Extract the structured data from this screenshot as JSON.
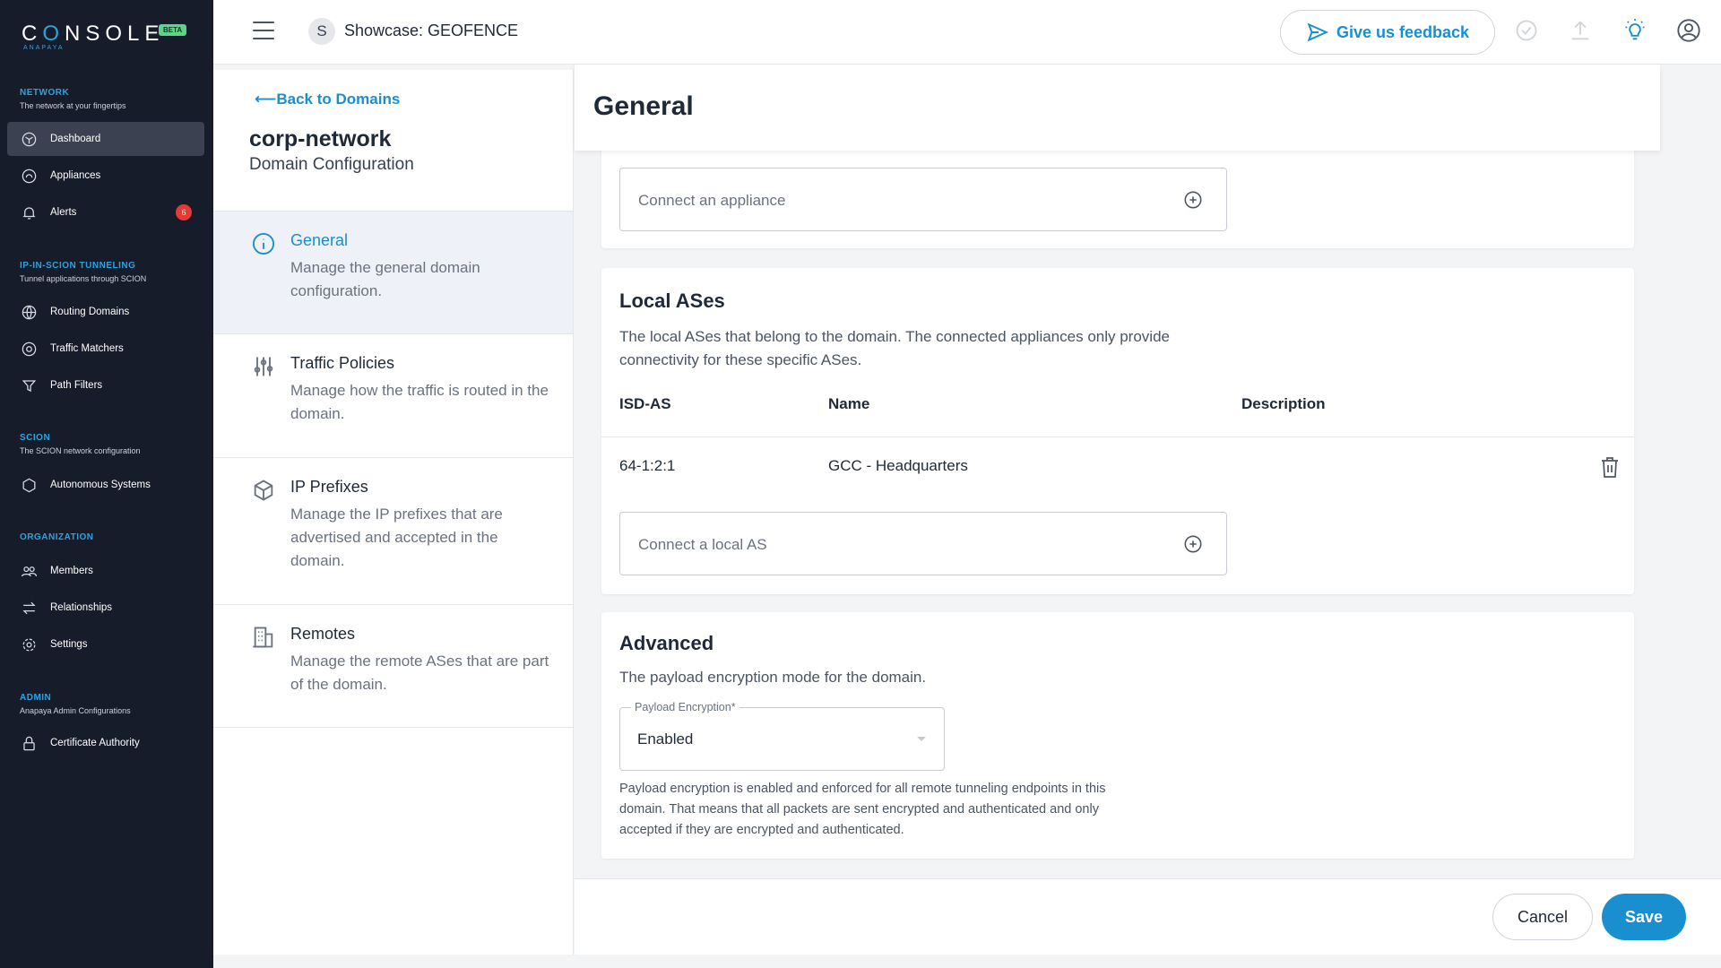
{
  "brand": {
    "logo_text_pre": "C",
    "logo_text_o": "O",
    "logo_text_post": "NSOLE",
    "logo_sub": "ANAPAYA",
    "badge": "BETA"
  },
  "sidebar": {
    "sections": [
      {
        "title": "Network",
        "subtitle": "The network at your fingertips"
      },
      {
        "title": "IP-in-SCION Tunneling",
        "subtitle": "Tunnel applications through SCION"
      },
      {
        "title": "SCION",
        "subtitle": "The SCION network configuration"
      },
      {
        "title": "Organization",
        "subtitle": ""
      },
      {
        "title": "Admin",
        "subtitle": "Anapaya Admin Configurations"
      }
    ],
    "items": [
      {
        "label": "Dashboard",
        "icon": "dashboard-icon"
      },
      {
        "label": "Appliances",
        "icon": "appliance-icon"
      },
      {
        "label": "Alerts",
        "icon": "bell-icon",
        "badge": "6"
      },
      {
        "label": "Routing Domains",
        "icon": "globe-icon"
      },
      {
        "label": "Traffic Matchers",
        "icon": "compass-icon"
      },
      {
        "label": "Path Filters",
        "icon": "filter-icon"
      },
      {
        "label": "Autonomous Systems",
        "icon": "hexagon-icon"
      },
      {
        "label": "Members",
        "icon": "users-icon"
      },
      {
        "label": "Relationships",
        "icon": "arrows-icon"
      },
      {
        "label": "Settings",
        "icon": "gear-icon"
      },
      {
        "label": "Certificate Authority",
        "icon": "lock-icon"
      }
    ]
  },
  "topbar": {
    "workspace_initial": "S",
    "workspace_title": "Showcase: GEOFENCE",
    "feedback_label": "Give us feedback"
  },
  "config": {
    "back_label": "⟵Back to Domains",
    "domain_name": "corp-network",
    "domain_subtitle": "Domain Configuration",
    "items": [
      {
        "title": "General",
        "desc": "Manage the general domain configuration."
      },
      {
        "title": "Traffic Policies",
        "desc": "Manage how the traffic is routed in the domain."
      },
      {
        "title": "IP Prefixes",
        "desc": "Manage the IP prefixes that are advertised and accepted in the domain."
      },
      {
        "title": "Remotes",
        "desc": "Manage the remote ASes that are part of the domain."
      }
    ]
  },
  "main": {
    "title": "General",
    "appliance_placeholder": "Connect an appliance",
    "local_ases": {
      "title": "Local ASes",
      "desc": "The local ASes that belong to the domain. The connected appliances only provide connectivity for these specific ASes.",
      "columns": [
        "ISD-AS",
        "Name",
        "Description"
      ],
      "rows": [
        {
          "isd_as": "64-1:2:1",
          "name": "GCC - Headquarters",
          "description": ""
        }
      ],
      "connect_placeholder": "Connect a local AS"
    },
    "advanced": {
      "title": "Advanced",
      "desc": "The payload encryption mode for the domain.",
      "select_label": "Payload Encryption*",
      "select_value": "Enabled",
      "helper": "Payload encryption is enabled and enforced for all remote tunneling endpoints in this domain. That means that all packets are sent encrypted and authenticated and only accepted if they are encrypted and authenticated."
    }
  },
  "footer": {
    "cancel_label": "Cancel",
    "save_label": "Save"
  },
  "colors": {
    "accent": "#1a8fd0",
    "sidebar_bg": "#171c2b",
    "badge_red": "#e53935",
    "beta_green": "#5ed38a"
  }
}
